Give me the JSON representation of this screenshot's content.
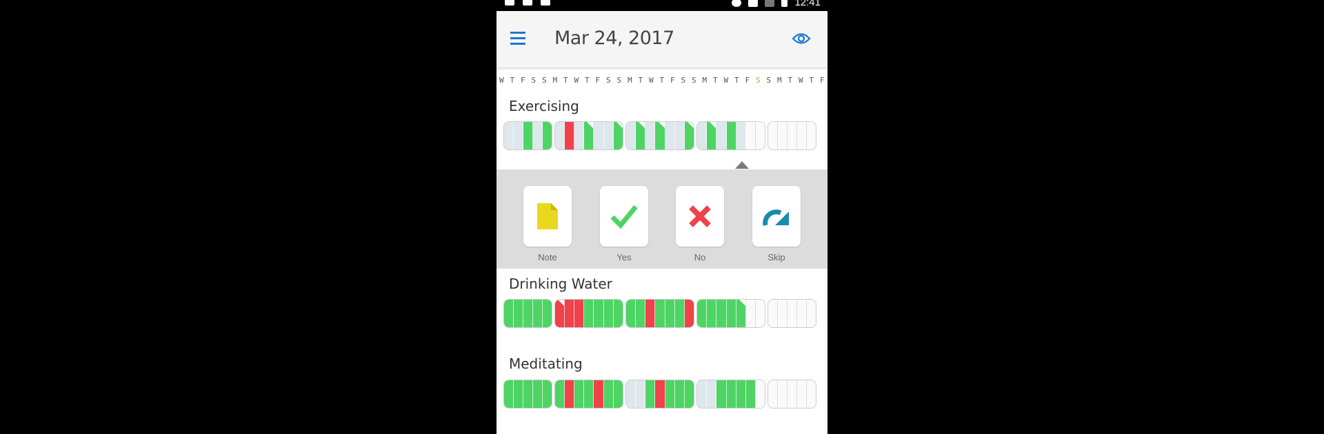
{
  "statusbar": {
    "time": "12:41"
  },
  "header": {
    "date_title": "Mar 24, 2017"
  },
  "day_letters": [
    "W",
    "T",
    "F",
    "S",
    "S",
    "M",
    "T",
    "W",
    "T",
    "F",
    "S",
    "S",
    "M",
    "T",
    "W",
    "T",
    "F",
    "S",
    "S",
    "M",
    "T",
    "W",
    "T",
    "F",
    "S",
    "S",
    "M",
    "T",
    "W",
    "T",
    "F"
  ],
  "today_index": 24,
  "habits": [
    {
      "name": "Exercising"
    },
    {
      "name": "Drinking Water"
    },
    {
      "name": "Meditating"
    }
  ],
  "actions": {
    "note": "Note",
    "yes": "Yes",
    "no": "No",
    "skip": "Skip"
  },
  "colors": {
    "accent": "#1976d2",
    "done": "#4ed465",
    "missed": "#f0424a",
    "skipped": "#dde7ec",
    "today_highlight": "#e69a1f",
    "note_icon": "#e8d81e",
    "skip_icon": "#1a8bb0"
  }
}
